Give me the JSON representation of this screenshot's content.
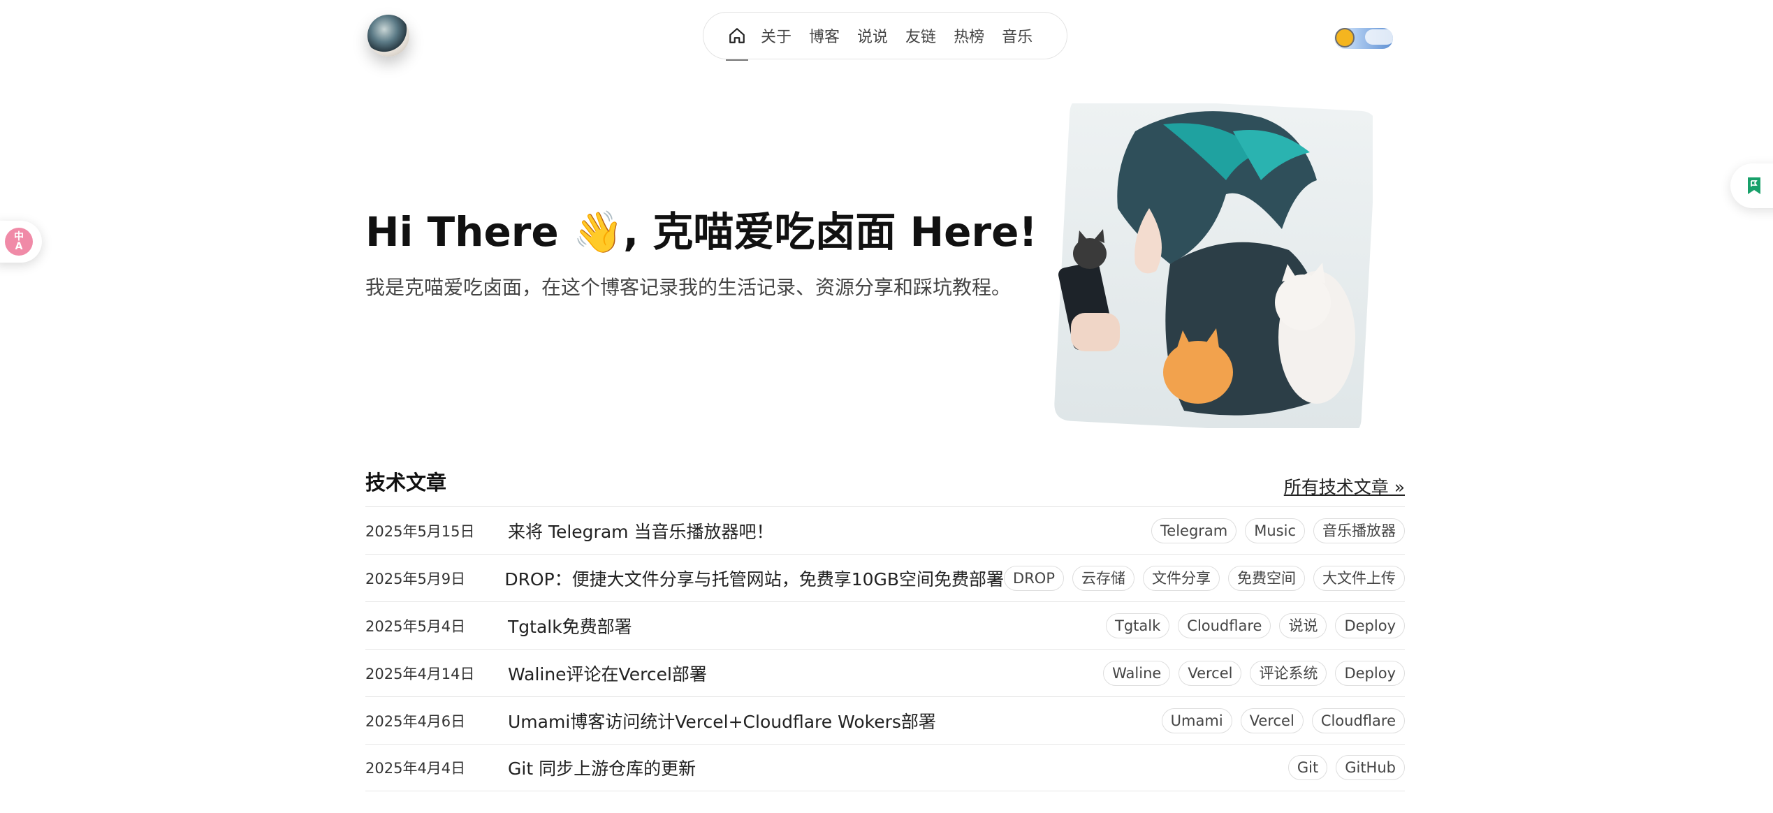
{
  "nav": {
    "home_icon": "home-icon",
    "items": [
      "关于",
      "博客",
      "说说",
      "友链",
      "热榜",
      "音乐"
    ]
  },
  "theme_toggle": {
    "icon": "sun-icon",
    "state": "light"
  },
  "side": {
    "translate_text_top": "中",
    "translate_text_bottom": "A"
  },
  "hero": {
    "title_part1": "Hi There ",
    "emoji": "👋",
    "title_part2": ", 克喵爱吃卤面 Here!",
    "subtitle": "我是克喵爱吃卤面，在这个博客记录我的生活记录、资源分享和踩坑教程。"
  },
  "section": {
    "title": "技术文章",
    "all_link": "所有技术文章 »"
  },
  "articles": [
    {
      "date": "2025年5月15日",
      "title": "来将 Telegram 当音乐播放器吧！",
      "tags": [
        "Telegram",
        "Music",
        "音乐播放器"
      ]
    },
    {
      "date": "2025年5月9日",
      "title": "DROP：便捷大文件分享与托管网站，免费享10GB空间免费部署",
      "tags": [
        "DROP",
        "云存储",
        "文件分享",
        "免费空间",
        "大文件上传"
      ]
    },
    {
      "date": "2025年5月4日",
      "title": "Tgtalk免费部署",
      "tags": [
        "Tgtalk",
        "Cloudflare",
        "说说",
        "Deploy"
      ]
    },
    {
      "date": "2025年4月14日",
      "title": "Waline评论在Vercel部署",
      "tags": [
        "Waline",
        "Vercel",
        "评论系统",
        "Deploy"
      ]
    },
    {
      "date": "2025年4月6日",
      "title": "Umami博客访问统计Vercel+Cloudflare Wokers部署",
      "tags": [
        "Umami",
        "Vercel",
        "Cloudflare"
      ]
    },
    {
      "date": "2025年4月4日",
      "title": "Git 同步上游仓库的更新",
      "tags": [
        "Git",
        "GitHub"
      ]
    }
  ]
}
